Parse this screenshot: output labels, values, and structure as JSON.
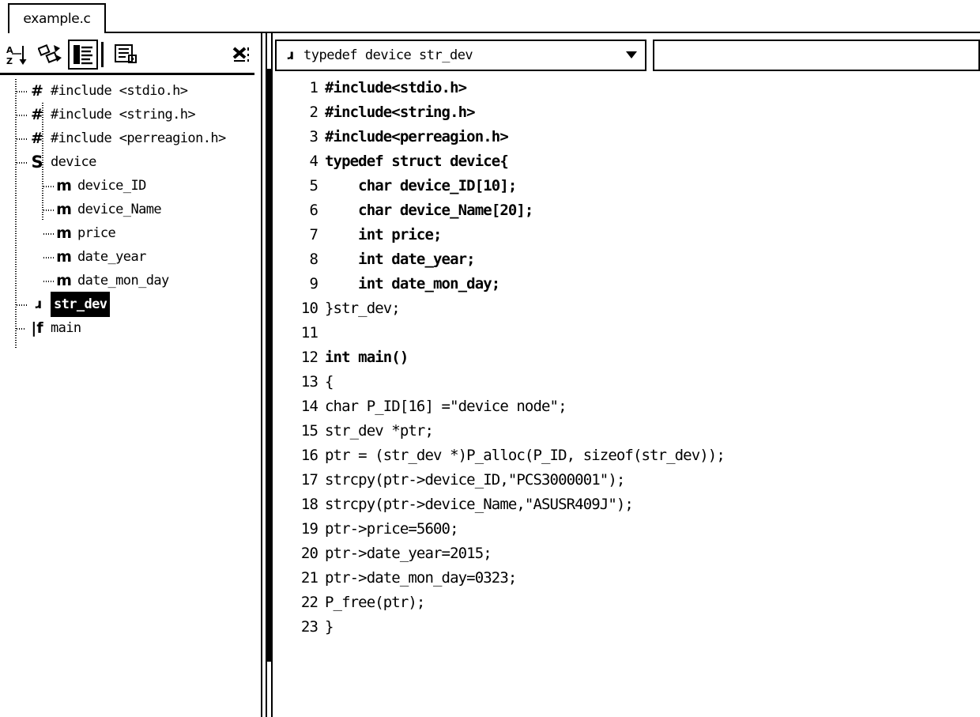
{
  "window": {
    "tabs": [
      {
        "label": "example.c",
        "active": true
      }
    ]
  },
  "left_pane": {
    "toolbar": {
      "buttons": [
        {
          "name": "sort-alphabetical-button",
          "icon": "sort-az-icon",
          "glyph": "A\nZ",
          "pressed": false
        },
        {
          "name": "sort-by-type-button",
          "icon": "shuffle-symbols-icon",
          "glyph": "⁂",
          "pressed": false
        },
        {
          "name": "show-members-button",
          "icon": "list-view-icon",
          "glyph": "☰",
          "pressed": true
        },
        {
          "name": "show-details-button",
          "icon": "list-detail-icon",
          "glyph": "☷",
          "pressed": false
        },
        {
          "name": "close-pane-button",
          "icon": "close-x-icon",
          "glyph": "✖",
          "pressed": false
        }
      ]
    },
    "tree": {
      "items": [
        {
          "icon": "preprocessor-hash-icon",
          "icon_glyph": "#",
          "label": "#include <stdio.h>",
          "depth": 0,
          "selected": false
        },
        {
          "icon": "preprocessor-hash-icon",
          "icon_glyph": "#",
          "label": "#include <string.h>",
          "depth": 0,
          "selected": false
        },
        {
          "icon": "preprocessor-hash-icon",
          "icon_glyph": "#",
          "label": "#include <perreagion.h>",
          "depth": 0,
          "selected": false
        },
        {
          "icon": "struct-icon",
          "icon_glyph": "S",
          "label": "device",
          "depth": 0,
          "selected": false
        },
        {
          "icon": "member-icon",
          "icon_glyph": "m",
          "label": "device_ID",
          "depth": 1,
          "selected": false
        },
        {
          "icon": "member-icon",
          "icon_glyph": "m",
          "label": "device_Name",
          "depth": 1,
          "selected": false
        },
        {
          "icon": "member-icon",
          "icon_glyph": "m",
          "label": "price",
          "depth": 1,
          "selected": false
        },
        {
          "icon": "member-icon",
          "icon_glyph": "m",
          "label": "date_year",
          "depth": 1,
          "selected": false
        },
        {
          "icon": "member-icon",
          "icon_glyph": "m",
          "label": "date_mon_day",
          "depth": 1,
          "selected": false
        },
        {
          "icon": "typedef-icon",
          "icon_glyph": "t",
          "label": "str_dev",
          "depth": 0,
          "selected": true
        },
        {
          "icon": "function-icon",
          "icon_glyph": "f",
          "label": "main",
          "depth": 0,
          "selected": false
        }
      ]
    }
  },
  "right_pane": {
    "symbol_combo": {
      "icon": "typedef-icon",
      "icon_glyph": "t",
      "value": "typedef device str_dev",
      "arrow": "⌄"
    },
    "secondary_combo": {
      "value": ""
    },
    "code": {
      "lines": [
        {
          "n": "1",
          "text": "#include<stdio.h>",
          "bold": true
        },
        {
          "n": "2",
          "text": "#include<string.h>",
          "bold": true
        },
        {
          "n": "3",
          "text": "#include<perreagion.h>",
          "bold": true
        },
        {
          "n": "4",
          "text": "typedef struct device{",
          "bold": true
        },
        {
          "n": "5",
          "text": "    char device_ID[10];",
          "bold": true
        },
        {
          "n": "6",
          "text": "    char device_Name[20];",
          "bold": true
        },
        {
          "n": "7",
          "text": "    int price;",
          "bold": true
        },
        {
          "n": "8",
          "text": "    int date_year;",
          "bold": true
        },
        {
          "n": "9",
          "text": "    int date_mon_day;",
          "bold": true
        },
        {
          "n": "10",
          "text": "}str_dev;",
          "bold": false
        },
        {
          "n": "11",
          "text": "",
          "bold": false
        },
        {
          "n": "12",
          "text": "int main()",
          "bold": true
        },
        {
          "n": "13",
          "text": "{",
          "bold": false
        },
        {
          "n": "14",
          "text": "char P_ID[16] =\"device node\";",
          "bold": false
        },
        {
          "n": "15",
          "text": "str_dev *ptr;",
          "bold": false
        },
        {
          "n": "16",
          "text": "ptr = (str_dev *)P_alloc(P_ID, sizeof(str_dev));",
          "bold": false
        },
        {
          "n": "17",
          "text": "strcpy(ptr->device_ID,\"PCS3000001\");",
          "bold": false
        },
        {
          "n": "18",
          "text": "strcpy(ptr->device_Name,\"ASUSR409J\");",
          "bold": false
        },
        {
          "n": "19",
          "text": "ptr->price=5600;",
          "bold": false
        },
        {
          "n": "20",
          "text": "ptr->date_year=2015;",
          "bold": false
        },
        {
          "n": "21",
          "text": "ptr->date_mon_day=0323;",
          "bold": false
        },
        {
          "n": "22",
          "text": "P_free(ptr);",
          "bold": false
        },
        {
          "n": "23",
          "text": "}",
          "bold": false
        }
      ]
    }
  },
  "colors": {
    "background": "#ffffff",
    "foreground": "#000000",
    "selection_bg": "#000000",
    "selection_fg": "#ffffff"
  }
}
